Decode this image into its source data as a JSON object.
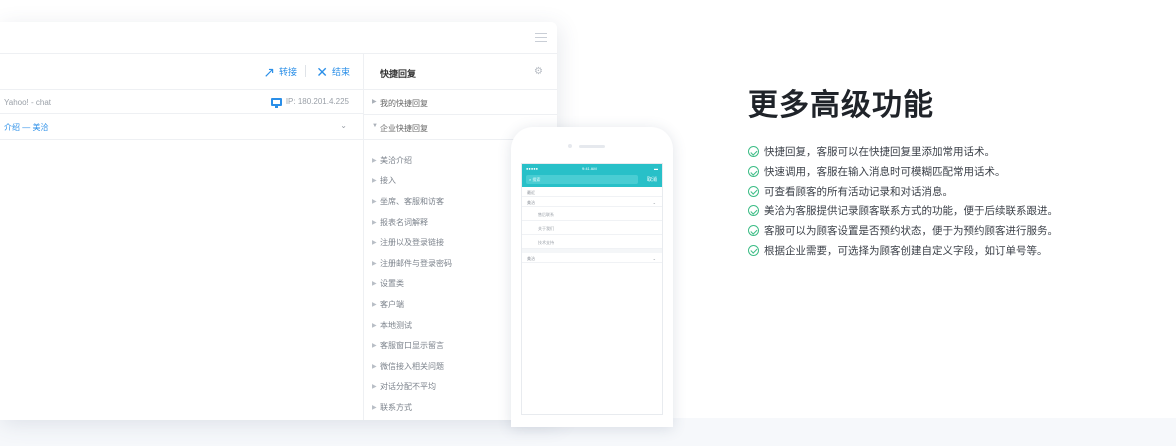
{
  "console": {
    "toolbar": {
      "transfer_label": "转接",
      "end_label": "结束"
    },
    "chat": {
      "source": "Yahoo! - chat",
      "ip": "IP: 180.201.4.225",
      "topic": "介绍 — 美洽"
    },
    "quick_reply": {
      "title": "快捷回复",
      "my_group": "我的快捷回复",
      "company_group": "企业快捷回复",
      "items": [
        "美洽介绍",
        "接入",
        "坐席、客服和访客",
        "报表名词解释",
        "注册以及登录链接",
        "注册邮件与登录密码",
        "设置类",
        "客户端",
        "本地测试",
        "客服窗口显示留言",
        "微信接入相关问题",
        "对话分配不平均",
        "联系方式"
      ]
    }
  },
  "phone": {
    "status_time": "9:41 AM",
    "search_placeholder": "搜索",
    "search_button": "取消",
    "rows": [
      "最近",
      "美洽"
    ],
    "sections": [
      "售后联系",
      "关于我们",
      "技术支持"
    ],
    "bottom_row": "美洽"
  },
  "features": {
    "title": "更多高级功能",
    "items": [
      "快捷回复，客服可以在快捷回复里添加常用话术。",
      "快速调用，客服在输入消息时可模糊匹配常用话术。",
      "可查看顾客的所有活动记录和对话消息。",
      "美洽为客服提供记录顾客联系方式的功能，便于后续联系跟进。",
      "客服可以为顾客设置是否预约状态，便于为预约顾客进行服务。",
      "根据企业需要，可选择为顾客创建自定义字段，如订单号等。"
    ]
  },
  "colors": {
    "accent": "#2b8fe8",
    "phone_bar": "#28c0c8",
    "check": "#3dbd86"
  }
}
